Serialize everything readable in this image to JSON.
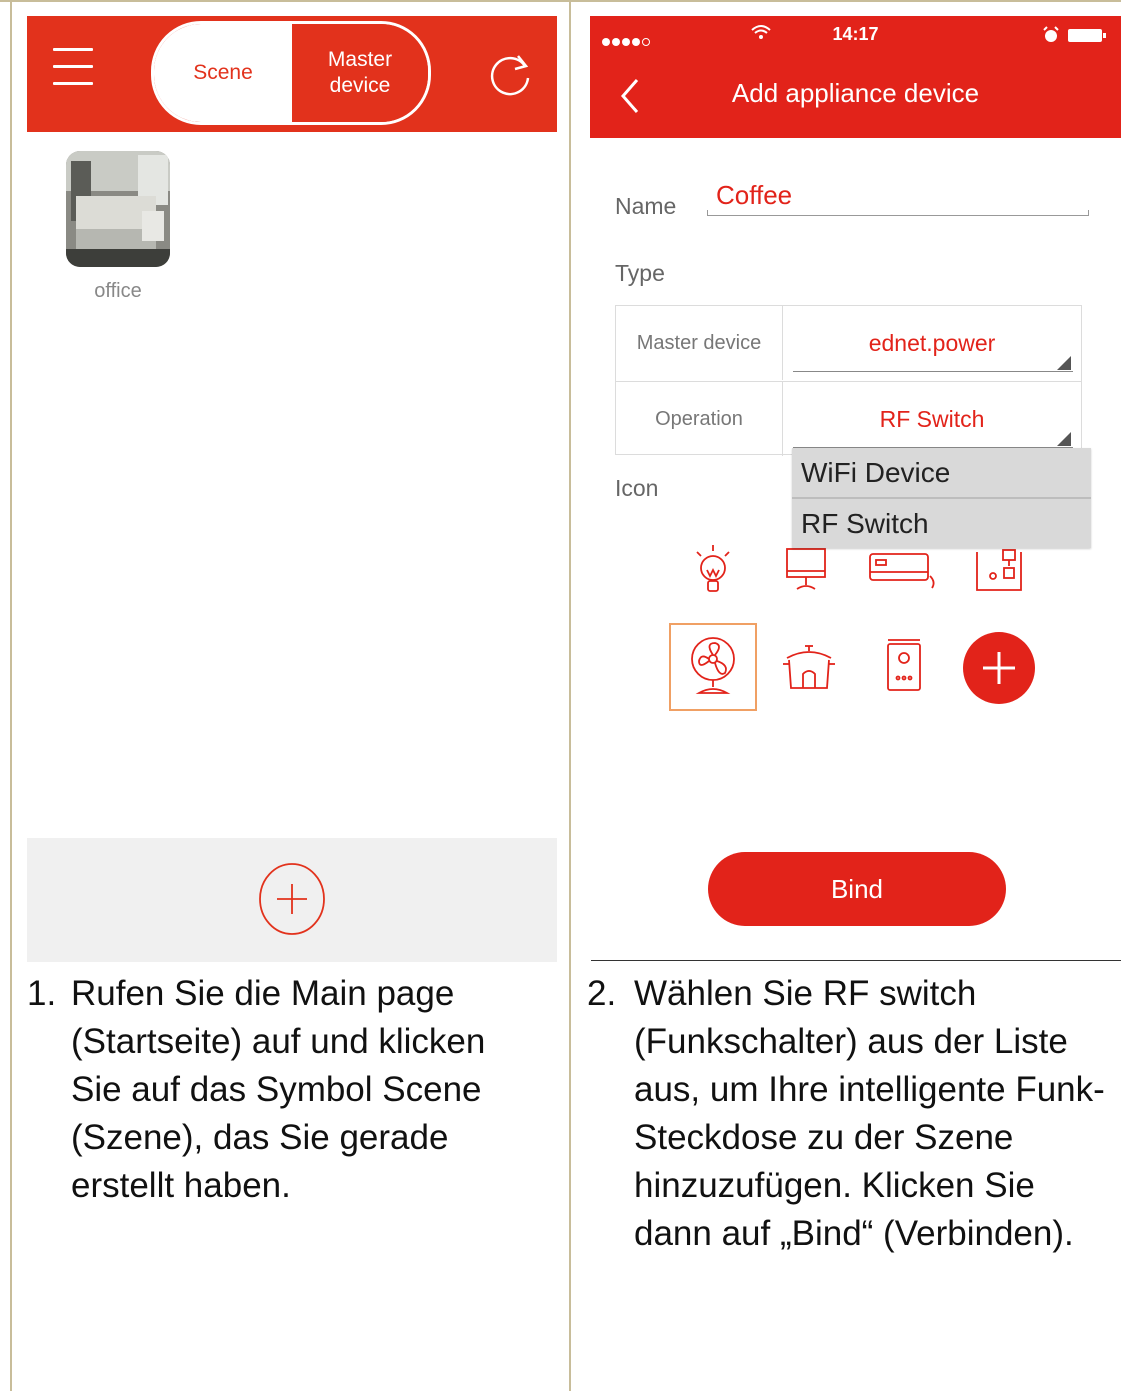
{
  "left": {
    "header": {
      "tab_scene": "Scene",
      "tab_master": "Master\ndevice",
      "accent": "#e2321c"
    },
    "scene": {
      "label": "office"
    },
    "instruction": {
      "number": "1.",
      "text": "Rufen Sie die Main page (Startseite) auf und klicken Sie auf das Symbol Scene (Szene), das Sie gerade erstellt haben."
    }
  },
  "right": {
    "status_bar": {
      "time": "14:17"
    },
    "header": {
      "title": "Add appliance device",
      "accent": "#e2231a"
    },
    "form": {
      "name_label": "Name",
      "name_value": "Coffee",
      "type_label": "Type",
      "rows": [
        {
          "key": "Master device",
          "value": "ednet.power"
        },
        {
          "key": "Operation",
          "value": "RF Switch"
        }
      ],
      "dropdown": [
        "WiFi Device",
        "RF Switch"
      ],
      "icon_label": "Icon"
    },
    "icons": [
      "bulb-icon",
      "monitor-icon",
      "air-conditioner-icon",
      "coffee-machine-icon",
      "fan-icon",
      "rice-cooker-icon",
      "water-heater-icon",
      "add-icon"
    ],
    "bind_label": "Bind",
    "instruction": {
      "number": "2.",
      "text": "Wählen Sie RF switch (Funkschalter) aus der Liste aus, um Ihre intelligente Funk-Steckdose zu der Szene hinzuzufügen. Klicken Sie dann auf „Bind“ (Verbinden)."
    }
  }
}
